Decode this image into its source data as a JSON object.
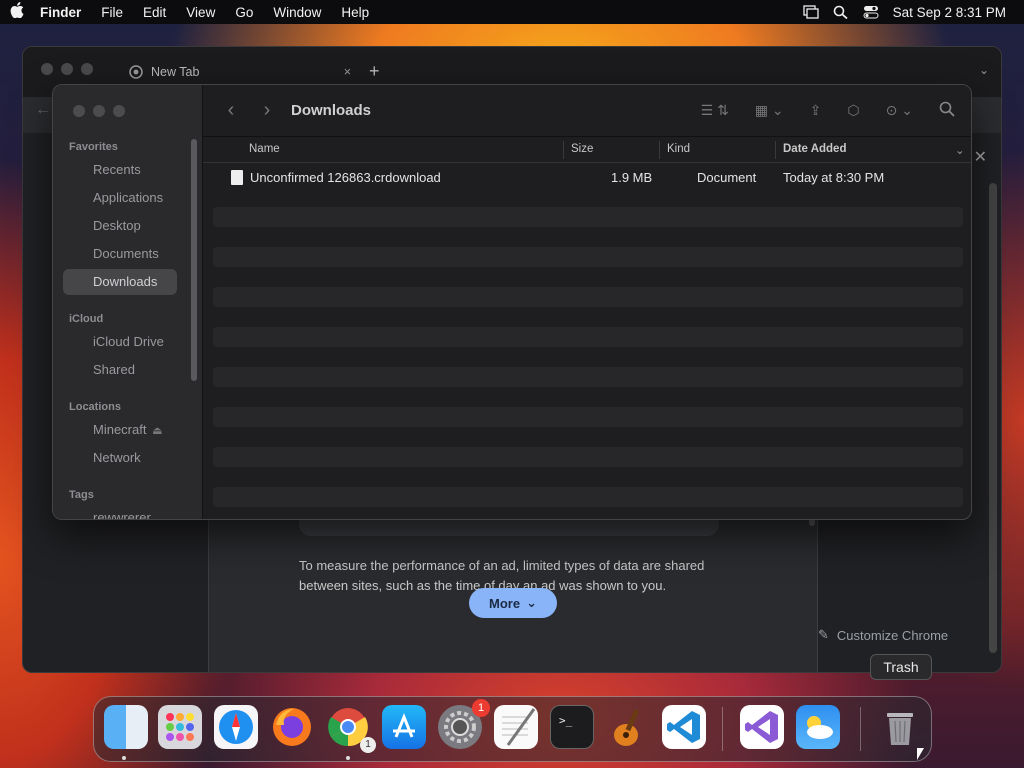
{
  "menubar": {
    "app_name": "Finder",
    "items": [
      "File",
      "Edit",
      "View",
      "Go",
      "Window",
      "Help"
    ],
    "datetime": "Sat Sep 2  8:31 PM"
  },
  "chrome": {
    "tab_title": "New Tab",
    "tab_close": "×",
    "new_tab": "+",
    "panel_text": "To measure the performance of an ad, limited types of data are shared between sites, such as the time of day an ad was shown to you.",
    "more_button": "More",
    "customize": "Customize Chrome"
  },
  "finder": {
    "title": "Downloads",
    "sidebar": {
      "favorites_label": "Favorites",
      "favorites": [
        "Recents",
        "Applications",
        "Desktop",
        "Documents",
        "Downloads"
      ],
      "selected": "Downloads",
      "icloud_label": "iCloud",
      "icloud": [
        "iCloud Drive",
        "Shared"
      ],
      "locations_label": "Locations",
      "locations": [
        "Minecraft",
        "Network"
      ],
      "tags_label": "Tags",
      "tags": [
        "rewwrerer"
      ]
    },
    "columns": {
      "name": "Name",
      "size": "Size",
      "kind": "Kind",
      "date_added": "Date Added"
    },
    "files": [
      {
        "name": "Unconfirmed 126863.crdownload",
        "size": "1.9 MB",
        "kind": "Document",
        "date_added": "Today at 8:30 PM"
      }
    ]
  },
  "dock": {
    "tooltip": "Trash",
    "apps": [
      "Finder",
      "Launchpad",
      "Safari",
      "Firefox",
      "Chrome",
      "App Store",
      "System Settings",
      "TextEdit",
      "Terminal",
      "GarageBand",
      "Visual Studio Code",
      "Visual Studio",
      "Weather",
      "Trash"
    ],
    "settings_badge": "1",
    "chrome_badge": "1"
  }
}
